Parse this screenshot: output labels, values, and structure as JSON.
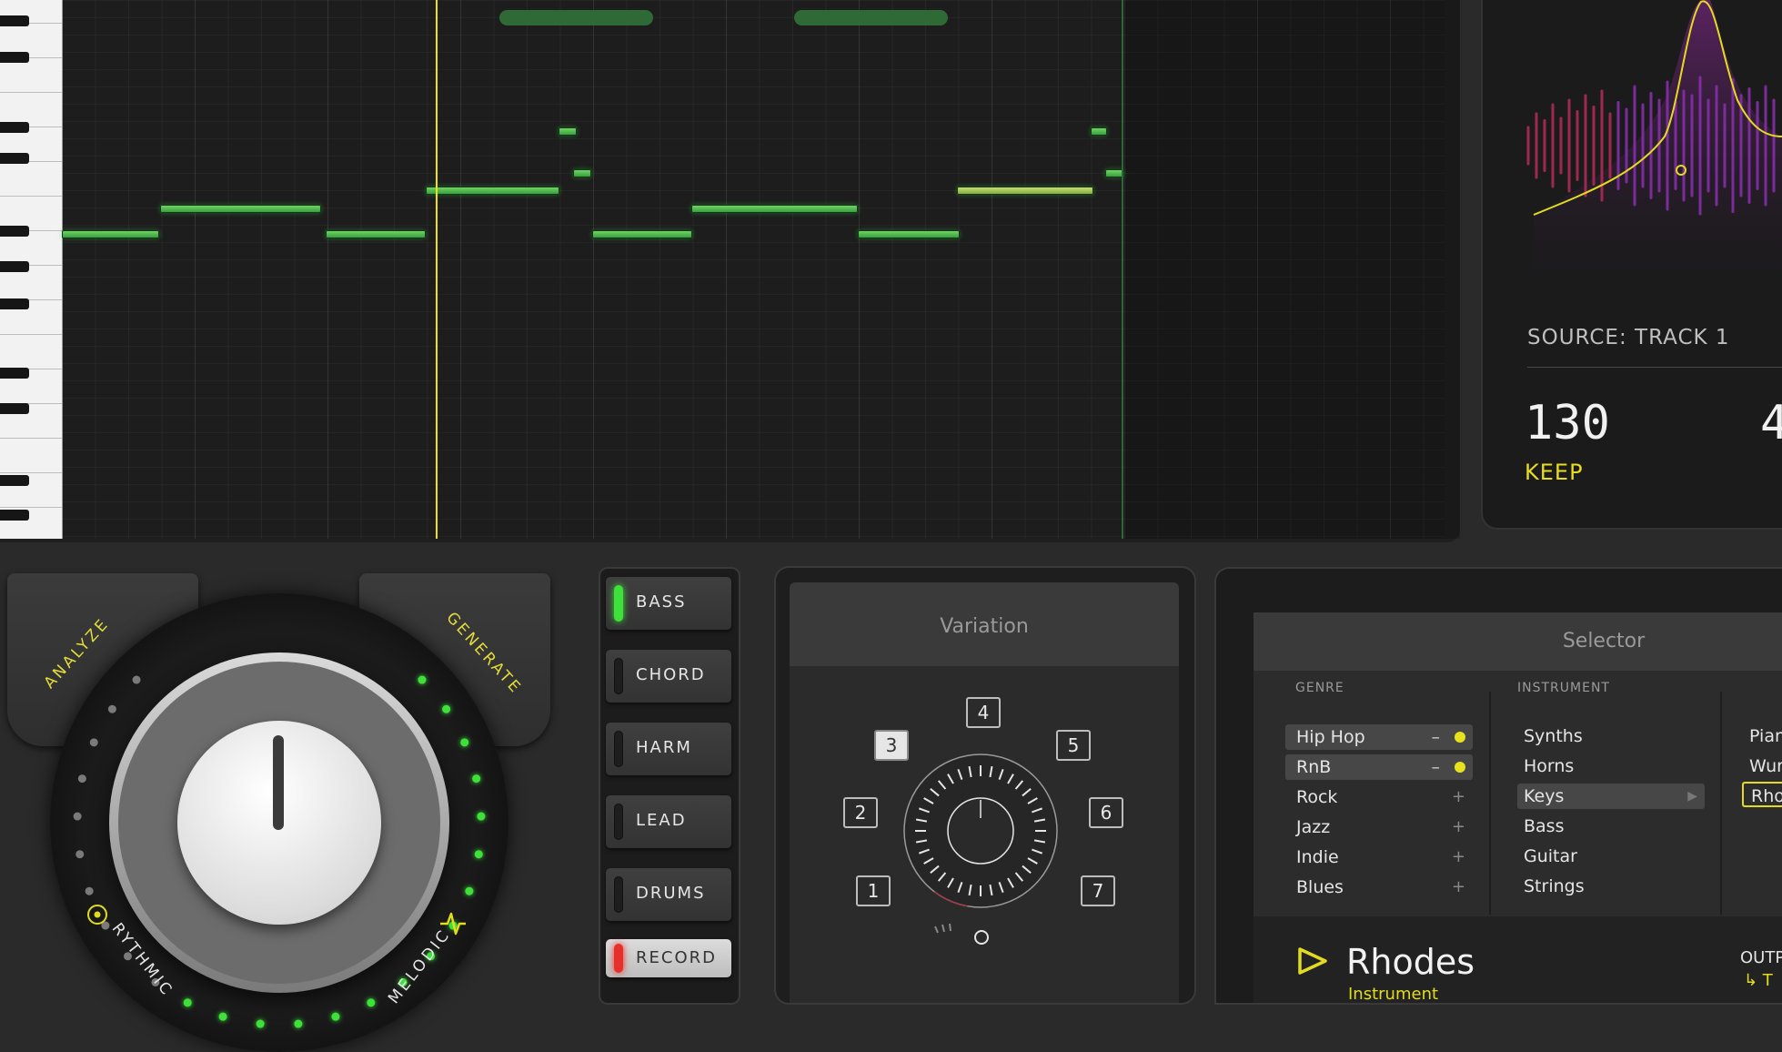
{
  "source": {
    "title": "SOURCE: TRACK 1",
    "tempo": "130",
    "tempo_mode": "KEEP",
    "second_value": "4"
  },
  "knob": {
    "left_tab": "ANALYZE",
    "right_tab": "GENERATE",
    "left_mode": "RYTHMIC",
    "right_mode": "MELODIC"
  },
  "tracks": [
    {
      "label": "BASS",
      "state": "on"
    },
    {
      "label": "CHORD",
      "state": "off"
    },
    {
      "label": "HARM",
      "state": "off"
    },
    {
      "label": "LEAD",
      "state": "off"
    },
    {
      "label": "DRUMS",
      "state": "off"
    },
    {
      "label": "RECORD",
      "state": "record"
    }
  ],
  "variation": {
    "title": "Variation",
    "slots": [
      "1",
      "2",
      "3",
      "4",
      "5",
      "6",
      "7"
    ],
    "selected": "3"
  },
  "selector": {
    "title": "Selector",
    "genre_header": "GENRE",
    "instrument_header": "INSTRUMENT",
    "genres": [
      {
        "label": "Hip Hop",
        "mark": "–",
        "active": true
      },
      {
        "label": "RnB",
        "mark": "–",
        "active": true
      },
      {
        "label": "Rock",
        "mark": "+",
        "active": false
      },
      {
        "label": "Jazz",
        "mark": "+",
        "active": false
      },
      {
        "label": "Indie",
        "mark": "+",
        "active": false
      },
      {
        "label": "Blues",
        "mark": "+",
        "active": false
      }
    ],
    "instruments": [
      "Synths",
      "Horns",
      "Keys",
      "Bass",
      "Guitar",
      "Strings"
    ],
    "selected_instrument": "Keys",
    "sub_items": [
      "Pian",
      "Wur",
      "Rho"
    ],
    "selected_sub": "Rho",
    "current": {
      "name": "Rhodes",
      "type": "Instrument"
    },
    "output_label": "OUTP",
    "output_sub": "↳ T"
  },
  "colors": {
    "accent": "#e3dc1e",
    "note_green": "#5ccc5a",
    "record_red": "#e8302a"
  }
}
